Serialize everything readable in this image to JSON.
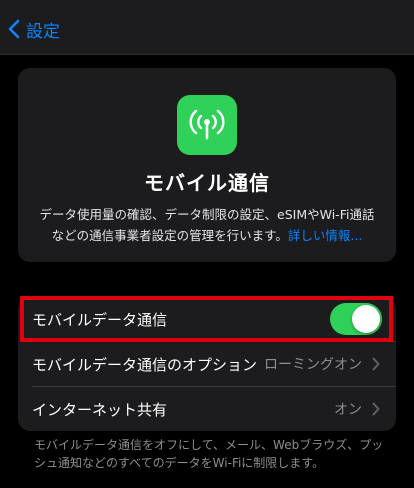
{
  "nav": {
    "back_label": "設定"
  },
  "info": {
    "icon": "antenna-icon",
    "title": "モバイル通信",
    "description": "データ使用量の確認、データ制限の設定、eSIMやWi-Fi通話などの通信事業者設定の管理を行います。",
    "link": "詳しい情報..."
  },
  "rows": [
    {
      "label": "モバイルデータ通信",
      "toggle_on": true
    },
    {
      "label": "モバイルデータ通信のオプション",
      "value": "ローミングオン"
    },
    {
      "label": "インターネット共有",
      "value": "オン"
    }
  ],
  "footer": "モバイルデータ通信をオフにして、メール、Webブラウズ、プッシュ通知などのすべてのデータをWi-Fiに制限します。",
  "colors": {
    "accent": "#0a84ff",
    "toggle_on": "#30d158",
    "highlight": "#e0000f"
  }
}
